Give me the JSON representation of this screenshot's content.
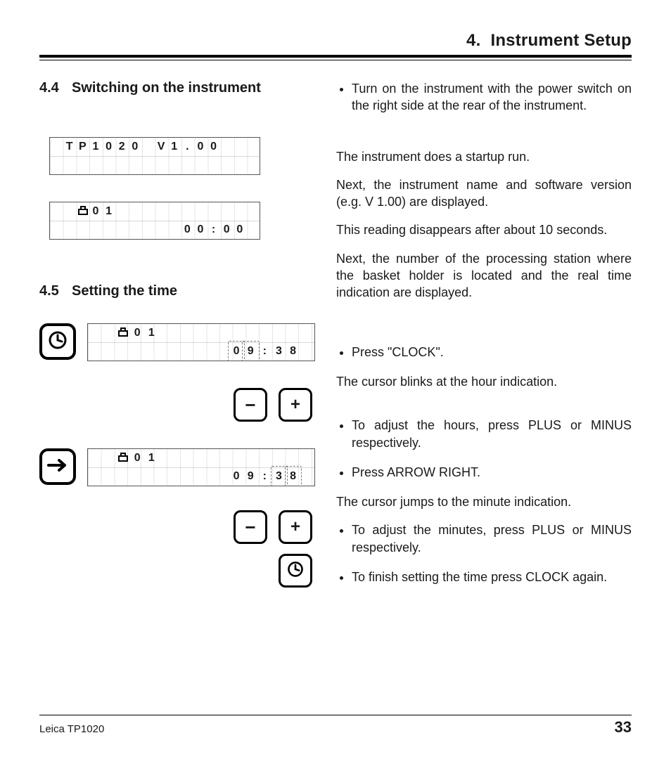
{
  "header": {
    "chapter_number": "4.",
    "chapter_title": "Instrument Setup"
  },
  "footer": {
    "model": "Leica TP1020",
    "page": "33"
  },
  "sec44": {
    "number": "4.4",
    "title": "Switching on the instrument",
    "lcd1_row1": [
      "",
      "T",
      "P",
      "1",
      "0",
      "2",
      "0",
      "",
      "V",
      "1",
      ".",
      "0",
      "0",
      "",
      "",
      ""
    ],
    "lcd1_row2": [
      "",
      "",
      "",
      "",
      "",
      "",
      "",
      "",
      "",
      "",
      "",
      "",
      "",
      "",
      "",
      ""
    ],
    "lcd2_row1": [
      "",
      "",
      "⎵",
      "0",
      "1",
      "",
      "",
      "",
      "",
      "",
      "",
      "",
      "",
      "",
      "",
      ""
    ],
    "lcd2_row2": [
      "",
      "",
      "",
      "",
      "",
      "",
      "",
      "",
      "",
      "",
      "0",
      "0",
      ":",
      "0",
      "0",
      ""
    ]
  },
  "sec45": {
    "number": "4.5",
    "title": "Setting the time",
    "lcdA_row1": [
      "",
      "",
      "⎵",
      "0",
      "1",
      "",
      "",
      "",
      "",
      "",
      "",
      "",
      "",
      "",
      "",
      ""
    ],
    "lcdA_row2": [
      "",
      "",
      "",
      "",
      "",
      "",
      "",
      "",
      "",
      "",
      "0",
      "9",
      ":",
      "3",
      "8",
      ""
    ],
    "lcdA_blink": [
      10,
      11
    ],
    "lcdB_row1": [
      "",
      "",
      "⎵",
      "0",
      "1",
      "",
      "",
      "",
      "",
      "",
      "",
      "",
      "",
      "",
      "",
      ""
    ],
    "lcdB_row2": [
      "",
      "",
      "",
      "",
      "",
      "",
      "",
      "",
      "",
      "",
      "0",
      "9",
      ":",
      "3",
      "8",
      ""
    ],
    "lcdB_blink": [
      13,
      14
    ]
  },
  "buttons": {
    "clock": "clock-icon",
    "minus": "−",
    "plus": "+",
    "arrow_right": "arrow-right-icon"
  },
  "right": {
    "b1": "Turn on the instrument with the power switch on the right side at the rear of the instrument.",
    "p1": "The instrument does a startup run.",
    "p2": "Next, the instrument name and software version (e.g. V 1.00) are displayed.",
    "p3": "This reading disappears after about 10 seconds.",
    "p4": "Next, the number of the processing station where the basket holder is located and the real time indication are displayed.",
    "b2": "Press \"CLOCK\".",
    "p5": "The cursor blinks at the hour indication.",
    "b3": "To adjust the hours, press PLUS or MINUS respectively.",
    "b4": "Press ARROW RIGHT.",
    "p6": "The cursor jumps to the minute indication.",
    "b5": "To adjust the minutes, press PLUS or MINUS respectively.",
    "b6": "To finish setting the time press CLOCK again."
  }
}
